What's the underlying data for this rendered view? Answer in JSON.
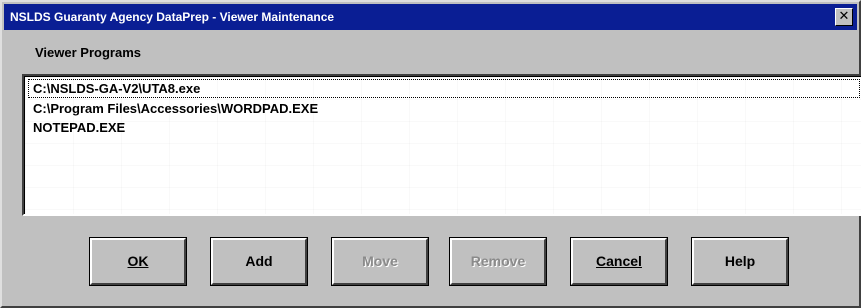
{
  "window": {
    "title": "NSLDS Guaranty Agency DataPrep - Viewer Maintenance",
    "close_glyph": "✕"
  },
  "group": {
    "label": "Viewer Programs"
  },
  "list": {
    "items": [
      {
        "label": "C:\\NSLDS-GA-V2\\UTA8.exe",
        "selected": true
      },
      {
        "label": "C:\\Program Files\\Accessories\\WORDPAD.EXE",
        "selected": false
      },
      {
        "label": "NOTEPAD.EXE",
        "selected": false
      }
    ]
  },
  "buttons": {
    "ok": {
      "label": "OK",
      "enabled": true
    },
    "add": {
      "label": "Add",
      "enabled": true
    },
    "move": {
      "label": "Move",
      "enabled": false
    },
    "remove": {
      "label": "Remove",
      "enabled": false
    },
    "cancel": {
      "label": "Cancel",
      "enabled": true
    },
    "help": {
      "label": "Help",
      "enabled": true
    }
  },
  "colors": {
    "titlebar": "#0a1e94",
    "face": "#c0c0c0",
    "disabled_text": "#8a8a8a"
  }
}
